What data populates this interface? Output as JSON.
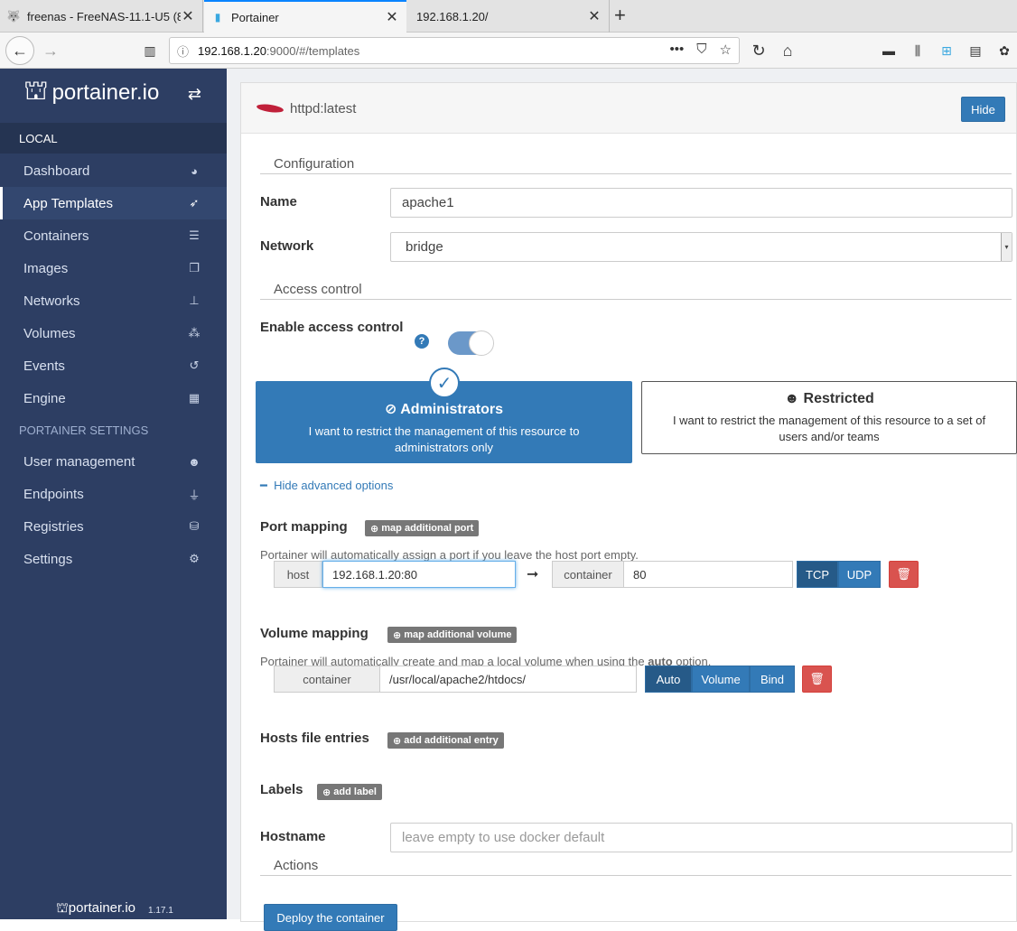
{
  "browser": {
    "tabs": [
      {
        "title": "freenas - FreeNAS-11.1-U5 (8",
        "icon": "freenas-icon"
      },
      {
        "title": "Portainer",
        "icon": "portainer-icon"
      },
      {
        "title": "192.168.1.20/",
        "icon": "none"
      }
    ],
    "url_host": "192.168.1.20",
    "url_rest": ":9000/#/templates"
  },
  "sidebar": {
    "brand": "portainer.io",
    "section_local": "LOCAL",
    "items": [
      {
        "label": "Dashboard",
        "icon": "tachometer-icon"
      },
      {
        "label": "App Templates",
        "icon": "rocket-icon"
      },
      {
        "label": "Containers",
        "icon": "server-icon"
      },
      {
        "label": "Images",
        "icon": "clone-icon"
      },
      {
        "label": "Networks",
        "icon": "sitemap-icon"
      },
      {
        "label": "Volumes",
        "icon": "cubes-icon"
      },
      {
        "label": "Events",
        "icon": "history-icon"
      },
      {
        "label": "Engine",
        "icon": "th-icon"
      }
    ],
    "section_settings": "PORTAINER SETTINGS",
    "settings_items": [
      {
        "label": "User management",
        "icon": "users-icon"
      },
      {
        "label": "Endpoints",
        "icon": "plug-icon"
      },
      {
        "label": "Registries",
        "icon": "database-icon"
      },
      {
        "label": "Settings",
        "icon": "cogs-icon"
      }
    ],
    "footer_brand": "portainer.io",
    "version": "1.17.1"
  },
  "template": {
    "title": "httpd:latest",
    "hide_label": "Hide",
    "config_legend": "Configuration",
    "name_label": "Name",
    "name_value": "apache1",
    "network_label": "Network",
    "network_value": "bridge",
    "access_legend": "Access control",
    "enable_access_label": "Enable access control",
    "access_enabled": true,
    "admin_title": "Administrators",
    "admin_desc": "I want to restrict the management of this resource to administrators only",
    "restricted_title": "Restricted",
    "restricted_desc": "I want to restrict the management of this resource to a set of users and/or teams",
    "hide_advanced": "Hide advanced options",
    "port_label": "Port mapping",
    "map_port_btn": "map additional port",
    "port_hint": "Portainer will automatically assign a port if you leave the host port empty.",
    "host_addon": "host",
    "host_value": "192.168.1.20:80",
    "container_addon": "container",
    "container_port": "80",
    "tcp": "TCP",
    "udp": "UDP",
    "volume_label": "Volume mapping",
    "map_volume_btn": "map additional volume",
    "volume_hint_pre": "Portainer will automatically create and map a local volume when using the ",
    "volume_hint_bold": "auto",
    "volume_hint_post": " option.",
    "volume_container_addon": "container",
    "volume_path": "/usr/local/apache2/htdocs/",
    "auto": "Auto",
    "volume": "Volume",
    "bind": "Bind",
    "hosts_label": "Hosts file entries",
    "add_entry_btn": "add additional entry",
    "labels_label": "Labels",
    "add_label_btn": "add label",
    "hostname_label": "Hostname",
    "hostname_placeholder": "leave empty to use docker default",
    "actions_legend": "Actions",
    "deploy_label": "Deploy the container"
  },
  "colors": {
    "sidebar": "#2d3e63",
    "primary": "#337ab7",
    "danger": "#d9534f"
  }
}
